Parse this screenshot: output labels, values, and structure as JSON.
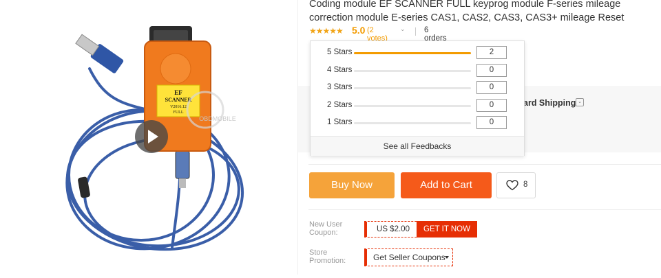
{
  "product": {
    "title": "Coding module EF SCANNER FULL keyprog module F-series mileage correction module E-series CAS1, CAS2, CAS3, CAS3+ mileage Reset",
    "device_label_line1": "EF",
    "device_label_line2": "SCANNER",
    "device_label_line3": "V2016.12",
    "device_label_line4": "FULL",
    "watermark": "OBDMOBILE"
  },
  "rating": {
    "stars_glyph": "★★★★★",
    "value": "5.0",
    "votes": "(2 votes)",
    "votes_chevron": "⌄",
    "orders": "6 orders"
  },
  "rating_popup": {
    "rows": [
      {
        "label": "5 Stars",
        "count": "2",
        "fraction": 1.0
      },
      {
        "label": "4 Stars",
        "count": "0",
        "fraction": 0
      },
      {
        "label": "3 Stars",
        "count": "0",
        "fraction": 0
      },
      {
        "label": "2 Stars",
        "count": "0",
        "fraction": 0
      },
      {
        "label": "1 Stars",
        "count": "0",
        "fraction": 0
      }
    ],
    "footer": "See all Feedbacks"
  },
  "shipping": {
    "partial_label": "ard Shipping",
    "chevron": "⌄"
  },
  "actions": {
    "buy_now": "Buy Now",
    "add_to_cart": "Add to Cart",
    "wishlist_count": "8"
  },
  "coupons": {
    "new_user_label": "New User Coupon:",
    "new_user_amount": "US $2.00",
    "get_it_now": "GET IT NOW",
    "store_label": "Store Promotion:",
    "store_button": "Get Seller Coupons"
  },
  "colors": {
    "rating_orange": "#f39b00",
    "buy_now": "#f5a33a",
    "add_to_cart": "#f55a1a",
    "coupon_red": "#e62e04"
  }
}
